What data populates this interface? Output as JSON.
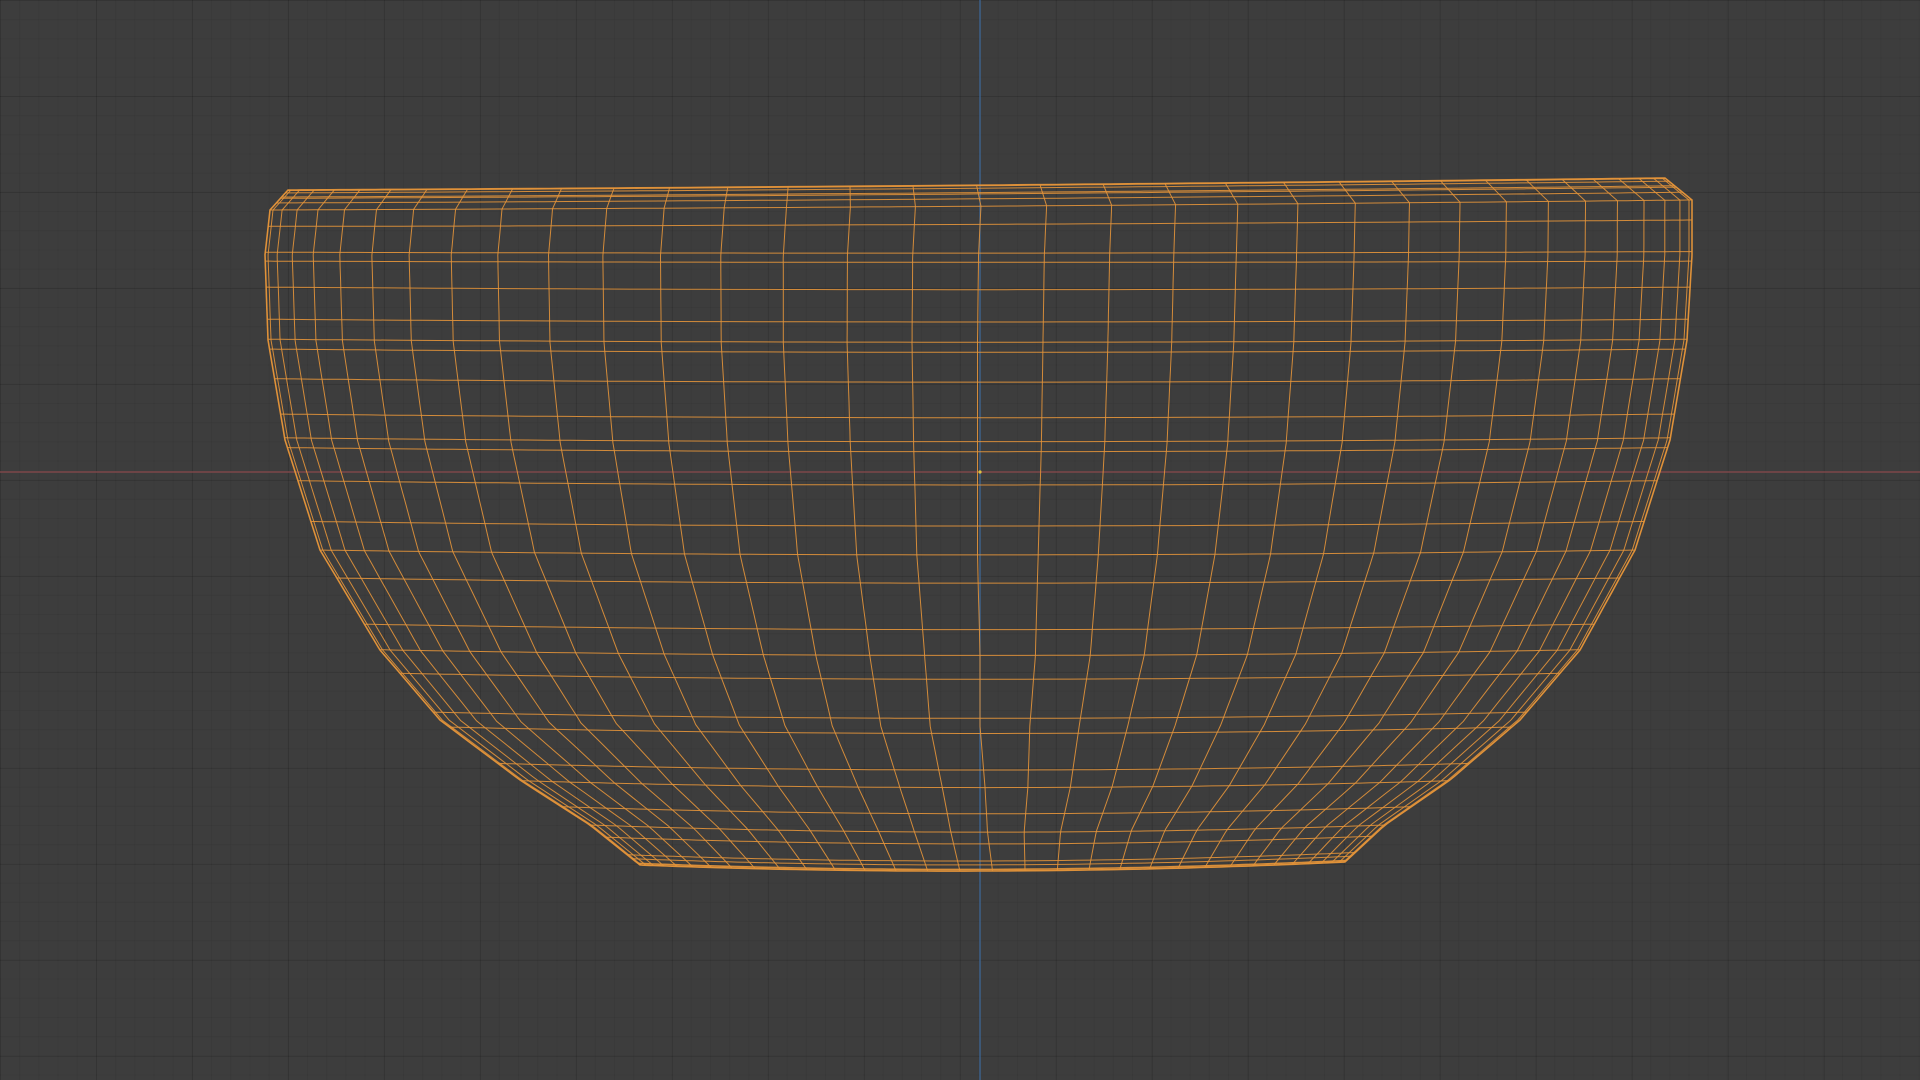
{
  "viewport": {
    "background_color": "#3d3d3d",
    "grid_color": "#353535",
    "x_axis_color": "#8a4a4d",
    "z_axis_color": "#3e6a9c",
    "origin_color": "#e0c040"
  },
  "mesh": {
    "name_icon": "bowl-wireframe-icon",
    "wire_color": "#e3943a",
    "selected": true,
    "display_mode": "wireframe"
  }
}
